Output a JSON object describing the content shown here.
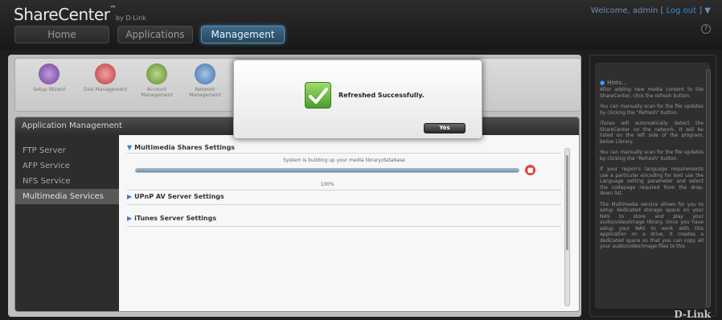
{
  "header": {
    "brand": "ShareCenter",
    "brand_tm": "™",
    "brand_by": "by D-Link",
    "welcome_prefix": "Welcome, admin [",
    "logout": " Log out ",
    "welcome_suffix": "] ▼",
    "help_icon": "?"
  },
  "nav": {
    "tabs": [
      {
        "label": "Home"
      },
      {
        "label": "Applications"
      },
      {
        "label": "Management"
      }
    ],
    "active": "Management"
  },
  "management_icons": [
    {
      "label": "Setup Wizard",
      "icon": "wizard-icon",
      "color": "#8a5ab8"
    },
    {
      "label": "Disk Management",
      "icon": "disk-icon",
      "color": "#c24848"
    },
    {
      "label": "Account Management",
      "icon": "account-icon",
      "color": "#6d9a3a"
    },
    {
      "label": "Network Management",
      "icon": "network-icon",
      "color": "#4a7fb8"
    }
  ],
  "app_management": {
    "title": "Application Management",
    "menu": [
      {
        "label": "FTP Server"
      },
      {
        "label": "AFP Service"
      },
      {
        "label": "NFS Service"
      },
      {
        "label": "Multimedia Services"
      }
    ],
    "active_menu": "Multimedia Services"
  },
  "content": {
    "multimedia_title": "Multimedia Shares Settings",
    "building_text": "System is building up your media library/database",
    "progress": 1.0,
    "percent_text": "100%",
    "upnp_title": "UPnP AV Server Settings",
    "itunes_title": "iTunes Server Settings"
  },
  "hints": {
    "title": "Hints...",
    "paragraphs": [
      "After adding new media content to the ShareCenter, click the refresh button.",
      "You can manually scan for the file updates by clicking the \"Refresh\" button.",
      "iTunes will automatically detect the ShareCenter on the network. It will be listed on the left side of the program, below Library.",
      "You can manually scan for the file updates by clicking the \"Refresh\" button.",
      "If your region's language requirements use a particular encoding for text use the Language setting parameter and select the codepage required from the drop-down list.",
      "The Multimedia service allows for you to setup dedicated storage space on your NAS to store and play your audio/video/image library. Once you have setup your NAS to work with this application on a drive, it creates a dedicated space so that you can copy all your audio/video/image files to this"
    ]
  },
  "footer_logo": "D-Link",
  "dialog": {
    "message": "Refreshed Successfully.",
    "yes_label": "Yes",
    "icon": "checkmark-icon"
  }
}
